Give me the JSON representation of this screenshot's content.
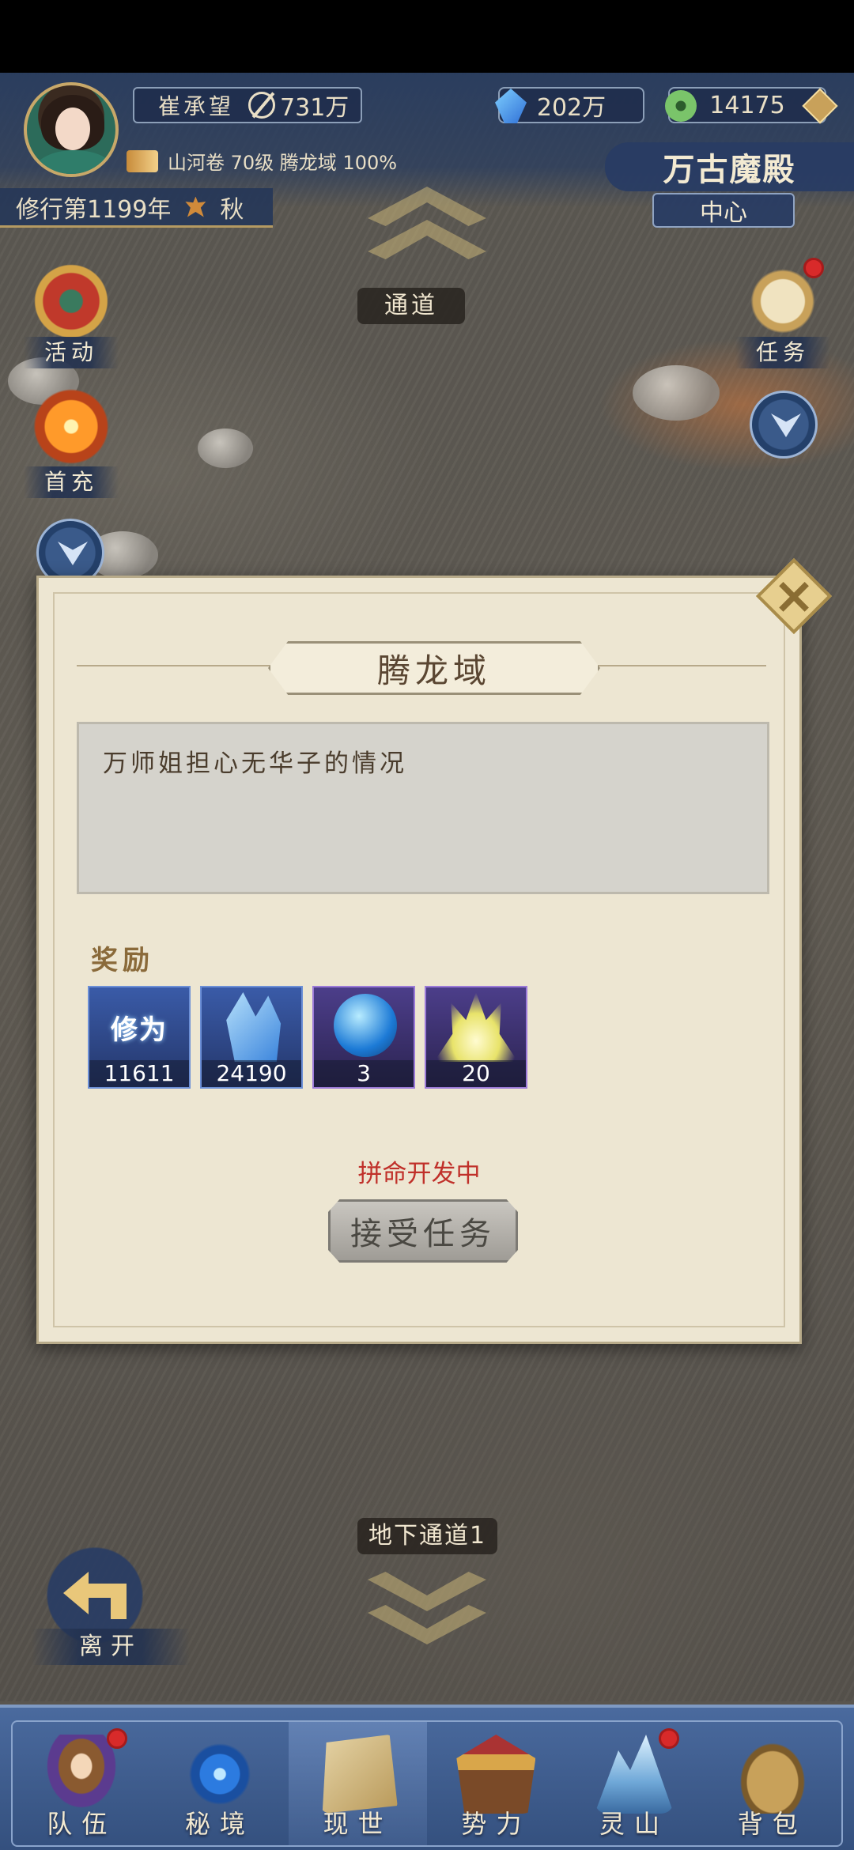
{
  "player": {
    "name": "崔承望",
    "power": "731万",
    "realm_text": "山河卷 70级 腾龙域 100%",
    "cultivation_year": "修行第1199年",
    "season": "秋"
  },
  "resources": {
    "crystal": "202万",
    "jade": "14175"
  },
  "location": {
    "name": "万古魔殿",
    "sub": "中心"
  },
  "side_buttons": {
    "activity": "活动",
    "first_charge": "首充",
    "task": "任务",
    "leave": "离开"
  },
  "passages": {
    "up": "通道",
    "down": "地下通道1"
  },
  "dialog": {
    "title": "腾龙域",
    "description": "万师姐担心无华子的情况",
    "reward_label": "奖励",
    "rewards": [
      {
        "label": "修为",
        "qty": "11611",
        "icon": "cultivation-icon"
      },
      {
        "label": "",
        "qty": "24190",
        "icon": "crystal-icon"
      },
      {
        "label": "",
        "qty": "3",
        "icon": "orb-icon"
      },
      {
        "label": "",
        "qty": "20",
        "icon": "flame-icon"
      }
    ],
    "dev_notice": "拼命开发中",
    "accept_button": "接受任务"
  },
  "bottom_nav": [
    {
      "label": "队伍",
      "badge": true
    },
    {
      "label": "秘境",
      "badge": false
    },
    {
      "label": "现世",
      "badge": false,
      "active": true
    },
    {
      "label": "势力",
      "badge": false
    },
    {
      "label": "灵山",
      "badge": true
    },
    {
      "label": "背包",
      "badge": false
    }
  ],
  "colors": {
    "hud_blue": "#283c5f",
    "gold": "#c8a869",
    "parchment": "#ede6d2",
    "notice_red": "#c0302a"
  }
}
